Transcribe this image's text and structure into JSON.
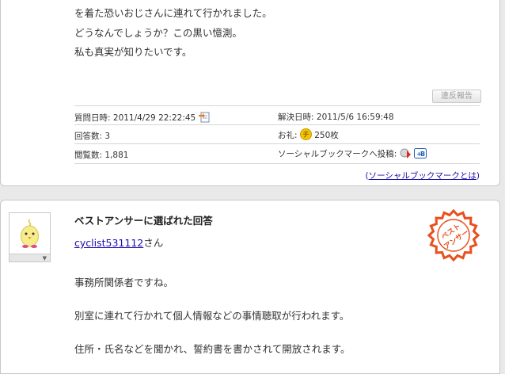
{
  "question": {
    "lines": [
      "を着た恐いおじさんに連れて行かれました。",
      "どうなんでしょうか？この黒い憶測。",
      "私も真実が知りたいです。"
    ],
    "report_label": "違反報告"
  },
  "meta": {
    "asked_label": "質問日時:",
    "asked_value": "2011/4/29 22:22:45",
    "resolved_label": "解決日時:",
    "resolved_value": "2011/5/6 16:59:48",
    "answers_label": "回答数:",
    "answers_value": "3",
    "reward_label": "お礼:",
    "reward_icon_char": "チ",
    "reward_value": "250枚",
    "views_label": "閲覧数:",
    "views_value": "1,881",
    "social_label": "ソーシャルブックマークへ投稿:",
    "social_b_label": "B",
    "social_link_open": "(",
    "social_link": "ソーシャルブックマークとは",
    "social_link_close": ")"
  },
  "best_answer": {
    "title": "ベストアンサーに選ばれた回答",
    "user": "cyclist531112",
    "user_suffix": "さん",
    "stamp_line1": "ベスト",
    "stamp_line2": "アンサー",
    "lines": [
      "事務所関係者ですね。",
      "別室に連れて行かれて個人情報などの事情聴取が行われます。",
      "住所・氏名などを聞かれ、誓約書を書かされて開放されます。"
    ]
  },
  "colors": {
    "link": "#1a0dab",
    "stamp": "#e8501d",
    "reward_coin": "#f5c400"
  }
}
